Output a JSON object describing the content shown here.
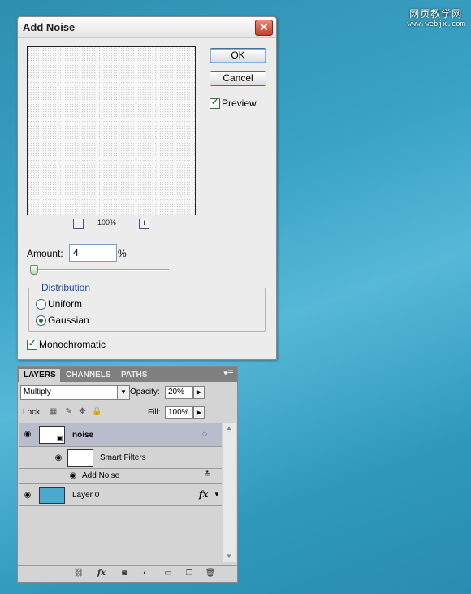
{
  "watermark": {
    "line1": "网页教学网",
    "line2": "www.webjx.com"
  },
  "dialog": {
    "title": "Add Noise",
    "ok_label": "OK",
    "cancel_label": "Cancel",
    "preview_label": "Preview",
    "preview_checked": true,
    "zoom_level": "100%",
    "zoom_out_label": "−",
    "zoom_in_label": "+",
    "amount_label": "Amount:",
    "amount_value": "4",
    "amount_unit": "%",
    "distribution_legend": "Distribution",
    "distribution_options": [
      "Uniform",
      "Gaussian"
    ],
    "distribution_selected": "Gaussian",
    "monochromatic_label": "Monochromatic",
    "monochromatic_checked": true
  },
  "layers_panel": {
    "tabs": [
      "LAYERS",
      "CHANNELS",
      "PATHS"
    ],
    "active_tab": "LAYERS",
    "blend_mode": "Multiply",
    "opacity_label": "Opacity:",
    "opacity_value": "20%",
    "lock_label": "Lock:",
    "fill_label": "Fill:",
    "fill_value": "100%",
    "layers": [
      {
        "name": "noise",
        "selected": true,
        "smart_object": true
      },
      {
        "name": "Smart Filters"
      },
      {
        "name": "Add Noise"
      },
      {
        "name": "Layer 0",
        "fx_label": "fx",
        "thumb_color": "#49a9cf"
      }
    ]
  }
}
